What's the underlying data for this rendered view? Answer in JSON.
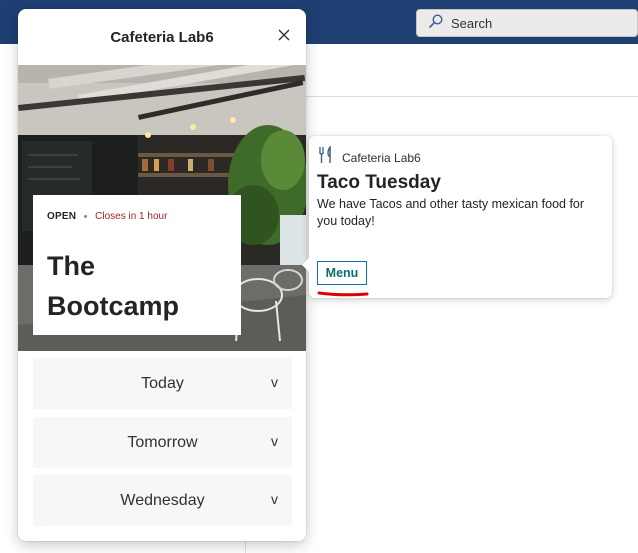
{
  "search": {
    "placeholder": "Search"
  },
  "panel": {
    "title": "Cafeteria Lab6",
    "status": "OPEN",
    "closes": "Closes in 1 hour",
    "venue_name": "The Bootcamp",
    "days": [
      {
        "label": "Today",
        "chevron": "v"
      },
      {
        "label": "Tomorrow",
        "chevron": "v"
      },
      {
        "label": "Wednesday",
        "chevron": "v"
      }
    ]
  },
  "card": {
    "source": "Cafeteria Lab6",
    "title": "Taco Tuesday",
    "body": "We have Tacos and other tasty mexican food for you today!",
    "button_label": "Menu"
  },
  "colors": {
    "topbar": "#1f3f72",
    "closes_text": "#a4262c",
    "menu_text": "#0f6c6f",
    "annotation": "#e00000"
  }
}
